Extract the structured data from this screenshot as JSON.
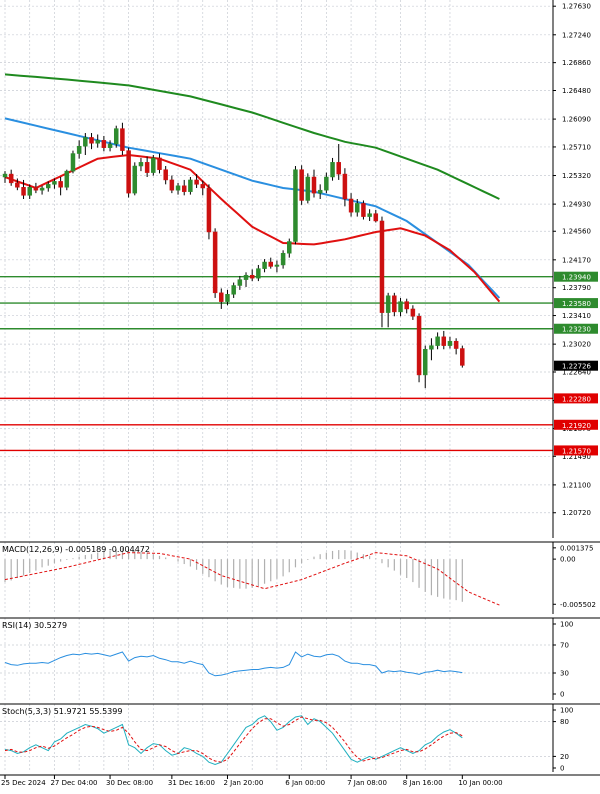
{
  "chart_data": [
    {
      "type": "candlestick",
      "pair_context": "price",
      "ylim": [
        1.2043,
        1.2766
      ],
      "y_ticks": [
        "1.27630",
        "1.27240",
        "1.26860",
        "1.26480",
        "1.26090",
        "1.25710",
        "1.25320",
        "1.24930",
        "1.24560",
        "1.24170",
        "1.23790",
        "1.23410",
        "1.23020",
        "1.22640",
        "1.22250",
        "1.21870",
        "1.21490",
        "1.21100",
        "1.20720"
      ],
      "current_price": "1.22726",
      "current_price_value": 1.22726,
      "support_resistance": [
        {
          "value": 1.2394,
          "label": "1.23940",
          "color": "#2e8b2e"
        },
        {
          "value": 1.2358,
          "label": "1.23580",
          "color": "#2e8b2e"
        },
        {
          "value": 1.2323,
          "label": "1.23230",
          "color": "#2e8b2e"
        },
        {
          "value": 1.2228,
          "label": "1.22280",
          "color": "#e00000"
        },
        {
          "value": 1.2192,
          "label": "1.21920",
          "color": "#e00000"
        },
        {
          "value": 1.2157,
          "label": "1.21570",
          "color": "#e00000"
        }
      ],
      "candles": [
        [
          1.253,
          1.2538,
          1.2522,
          1.2534
        ],
        [
          1.2534,
          1.254,
          1.2518,
          1.2522
        ],
        [
          1.2522,
          1.2528,
          1.2512,
          1.2516
        ],
        [
          1.2516,
          1.2526,
          1.25,
          1.2505
        ],
        [
          1.2505,
          1.252,
          1.25,
          1.2516
        ],
        [
          1.2516,
          1.2522,
          1.2508,
          1.2512
        ],
        [
          1.2512,
          1.2518,
          1.2506,
          1.2515
        ],
        [
          1.2515,
          1.2524,
          1.251,
          1.252
        ],
        [
          1.252,
          1.2528,
          1.2514,
          1.2524
        ],
        [
          1.2524,
          1.253,
          1.2505,
          1.2516
        ],
        [
          1.2516,
          1.254,
          1.2512,
          1.2538
        ],
        [
          1.2538,
          1.2566,
          1.2535,
          1.2562
        ],
        [
          1.2562,
          1.258,
          1.2555,
          1.2572
        ],
        [
          1.2572,
          1.259,
          1.256,
          1.2584
        ],
        [
          1.2584,
          1.259,
          1.2568,
          1.2576
        ],
        [
          1.2576,
          1.2588,
          1.257,
          1.258
        ],
        [
          1.258,
          1.2586,
          1.2565,
          1.257
        ],
        [
          1.257,
          1.258,
          1.2565,
          1.2575
        ],
        [
          1.2575,
          1.26,
          1.257,
          1.2596
        ],
        [
          1.2596,
          1.2604,
          1.256,
          1.2566
        ],
        [
          1.2566,
          1.257,
          1.2502,
          1.2508
        ],
        [
          1.2508,
          1.255,
          1.2505,
          1.2545
        ],
        [
          1.2545,
          1.2556,
          1.2538,
          1.255
        ],
        [
          1.255,
          1.2558,
          1.253,
          1.2536
        ],
        [
          1.2536,
          1.256,
          1.2532,
          1.2556
        ],
        [
          1.2556,
          1.2562,
          1.2535,
          1.254
        ],
        [
          1.254,
          1.2545,
          1.252,
          1.2526
        ],
        [
          1.2526,
          1.2532,
          1.2508,
          1.2512
        ],
        [
          1.2512,
          1.2522,
          1.2506,
          1.2518
        ],
        [
          1.2518,
          1.2526,
          1.2505,
          1.251
        ],
        [
          1.251,
          1.253,
          1.2506,
          1.2526
        ],
        [
          1.2526,
          1.2534,
          1.2515,
          1.252
        ],
        [
          1.252,
          1.2525,
          1.2505,
          1.2515
        ],
        [
          1.2515,
          1.252,
          1.2445,
          1.2455
        ],
        [
          1.2455,
          1.246,
          1.2365,
          1.2372
        ],
        [
          1.2372,
          1.2378,
          1.235,
          1.236
        ],
        [
          1.236,
          1.2376,
          1.2355,
          1.237
        ],
        [
          1.237,
          1.2386,
          1.2365,
          1.2382
        ],
        [
          1.2382,
          1.2395,
          1.2376,
          1.239
        ],
        [
          1.239,
          1.24,
          1.238,
          1.2396
        ],
        [
          1.2396,
          1.2404,
          1.2388,
          1.2392
        ],
        [
          1.2392,
          1.241,
          1.2388,
          1.2405
        ],
        [
          1.2405,
          1.2418,
          1.24,
          1.2414
        ],
        [
          1.2414,
          1.242,
          1.2405,
          1.2408
        ],
        [
          1.2408,
          1.2416,
          1.24,
          1.241
        ],
        [
          1.241,
          1.243,
          1.2405,
          1.2426
        ],
        [
          1.2426,
          1.2446,
          1.242,
          1.2442
        ],
        [
          1.2442,
          1.2545,
          1.2438,
          1.254
        ],
        [
          1.254,
          1.2546,
          1.2492,
          1.2498
        ],
        [
          1.2498,
          1.2535,
          1.2494,
          1.253
        ],
        [
          1.253,
          1.254,
          1.2502,
          1.2508
        ],
        [
          1.2508,
          1.252,
          1.25,
          1.2512
        ],
        [
          1.2512,
          1.2536,
          1.2508,
          1.253
        ],
        [
          1.253,
          1.2556,
          1.2525,
          1.255
        ],
        [
          1.255,
          1.2575,
          1.2526,
          1.2534
        ],
        [
          1.2534,
          1.2542,
          1.249,
          1.25
        ],
        [
          1.25,
          1.2508,
          1.2476,
          1.2482
        ],
        [
          1.2482,
          1.25,
          1.2476,
          1.2494
        ],
        [
          1.2494,
          1.2498,
          1.2472,
          1.2476
        ],
        [
          1.2476,
          1.2486,
          1.247,
          1.248
        ],
        [
          1.248,
          1.2485,
          1.2468,
          1.247
        ],
        [
          1.247,
          1.2476,
          1.2325,
          1.2345
        ],
        [
          1.2345,
          1.2372,
          1.2325,
          1.2368
        ],
        [
          1.2368,
          1.2372,
          1.234,
          1.2346
        ],
        [
          1.2346,
          1.2365,
          1.234,
          1.236
        ],
        [
          1.236,
          1.2364,
          1.2344,
          1.235
        ],
        [
          1.235,
          1.2355,
          1.2335,
          1.234
        ],
        [
          1.234,
          1.2344,
          1.225,
          1.226
        ],
        [
          1.226,
          1.23,
          1.2242,
          1.2295
        ],
        [
          1.2295,
          1.231,
          1.228,
          1.23
        ],
        [
          1.23,
          1.2318,
          1.2295,
          1.2312
        ],
        [
          1.2312,
          1.232,
          1.2295,
          1.23
        ],
        [
          1.23,
          1.2312,
          1.2296,
          1.2306
        ],
        [
          1.2306,
          1.231,
          1.2288,
          1.2296
        ],
        [
          1.2296,
          1.23,
          1.227,
          1.2273
        ]
      ],
      "ma_green": [
        [
          0,
          1.267
        ],
        [
          10,
          1.2663
        ],
        [
          20,
          1.2655
        ],
        [
          30,
          1.264
        ],
        [
          40,
          1.2618
        ],
        [
          50,
          1.259
        ],
        [
          55,
          1.2578
        ],
        [
          60,
          1.257
        ],
        [
          65,
          1.2555
        ],
        [
          70,
          1.254
        ],
        [
          75,
          1.252
        ],
        [
          80,
          1.25
        ]
      ],
      "ma_blue": [
        [
          0,
          1.261
        ],
        [
          10,
          1.259
        ],
        [
          20,
          1.257
        ],
        [
          30,
          1.2555
        ],
        [
          35,
          1.254
        ],
        [
          40,
          1.2525
        ],
        [
          45,
          1.2515
        ],
        [
          50,
          1.251
        ],
        [
          55,
          1.25
        ],
        [
          60,
          1.249
        ],
        [
          65,
          1.247
        ],
        [
          70,
          1.244
        ],
        [
          75,
          1.241
        ],
        [
          80,
          1.2365
        ]
      ],
      "ma_red": [
        [
          0,
          1.253
        ],
        [
          5,
          1.2515
        ],
        [
          10,
          1.2535
        ],
        [
          15,
          1.2555
        ],
        [
          20,
          1.256
        ],
        [
          25,
          1.2555
        ],
        [
          30,
          1.254
        ],
        [
          35,
          1.25
        ],
        [
          40,
          1.2462
        ],
        [
          45,
          1.244
        ],
        [
          50,
          1.2438
        ],
        [
          55,
          1.2445
        ],
        [
          60,
          1.2455
        ],
        [
          64,
          1.246
        ],
        [
          68,
          1.245
        ],
        [
          72,
          1.243
        ],
        [
          76,
          1.24
        ],
        [
          80,
          1.236
        ]
      ]
    },
    {
      "type": "histogram",
      "name": "MACD",
      "label": "MACD(12,26,9) -0.005189 -0.004472",
      "ylim": [
        -0.0062,
        0.0016
      ],
      "y_ticks": [
        "0.001375",
        "0.00",
        "-0.005502"
      ],
      "y_tick_values": [
        0.001375,
        0.0,
        -0.005502
      ],
      "bars": [
        -0.0028,
        -0.0026,
        -0.0023,
        -0.002,
        -0.0017,
        -0.0014,
        -0.001,
        -0.0008,
        -0.0005,
        -0.0003,
        -0.0001,
        0.0001,
        0.0003,
        0.0005,
        0.0006,
        0.0008,
        0.0009,
        0.001,
        0.0012,
        0.0014,
        0.0012,
        0.001,
        0.0009,
        0.0008,
        0.0006,
        0.0004,
        0.0002,
        0.0,
        -0.0003,
        -0.0006,
        -0.0009,
        -0.0013,
        -0.0018,
        -0.0022,
        -0.0027,
        -0.0031,
        -0.0034,
        -0.0035,
        -0.0036,
        -0.0036,
        -0.0035,
        -0.0033,
        -0.003,
        -0.0027,
        -0.0024,
        -0.0021,
        -0.0016,
        -0.001,
        -0.0005,
        -0.0001,
        0.0003,
        0.0006,
        0.0008,
        0.001,
        0.0011,
        0.0011,
        0.001,
        0.0008,
        0.0006,
        0.0004,
        0.0001,
        -0.0005,
        -0.001,
        -0.0014,
        -0.0019,
        -0.0023,
        -0.0028,
        -0.0035,
        -0.004,
        -0.0044,
        -0.0046,
        -0.0048,
        -0.0049,
        -0.005,
        -0.0052
      ],
      "signal": [
        [
          0,
          -0.0025
        ],
        [
          10,
          -0.001
        ],
        [
          20,
          0.0008
        ],
        [
          25,
          0.0007
        ],
        [
          30,
          0.0
        ],
        [
          35,
          -0.002
        ],
        [
          42,
          -0.0036
        ],
        [
          48,
          -0.0025
        ],
        [
          55,
          -0.0005
        ],
        [
          60,
          0.0008
        ],
        [
          65,
          0.0004
        ],
        [
          70,
          -0.0012
        ],
        [
          75,
          -0.004
        ],
        [
          80,
          -0.0056
        ]
      ]
    },
    {
      "type": "line",
      "name": "RSI",
      "label": "RSI(14) 30.5279",
      "ylim": [
        0,
        100
      ],
      "y_ticks": [
        "100",
        "70",
        "30",
        "0"
      ],
      "y_tick_values": [
        100,
        70,
        30,
        0
      ],
      "series": [
        45,
        42,
        41,
        43,
        44,
        44,
        45,
        44,
        48,
        52,
        55,
        57,
        56,
        58,
        57,
        58,
        56,
        54,
        57,
        60,
        47,
        52,
        54,
        53,
        55,
        51,
        49,
        46,
        46,
        44,
        47,
        44,
        42,
        30,
        26,
        27,
        29,
        32,
        33,
        34,
        35,
        35,
        37,
        38,
        37,
        38,
        42,
        60,
        53,
        57,
        54,
        53,
        56,
        57,
        54,
        47,
        44,
        44,
        42,
        42,
        40,
        30,
        33,
        32,
        33,
        31,
        30,
        28,
        31,
        32,
        34,
        32,
        33,
        32,
        30.5
      ]
    },
    {
      "type": "line",
      "name": "Stoch",
      "label": "Stoch(5,3,3) 51.9721 55.5399",
      "ylim": [
        0,
        100
      ],
      "y_ticks": [
        "100",
        "80",
        "20",
        "0"
      ],
      "y_tick_values": [
        100,
        80,
        20,
        0
      ],
      "k": [
        32,
        30,
        25,
        28,
        35,
        40,
        35,
        30,
        45,
        50,
        60,
        65,
        70,
        75,
        72,
        68,
        60,
        65,
        70,
        75,
        40,
        35,
        25,
        35,
        42,
        40,
        30,
        22,
        25,
        35,
        32,
        25,
        20,
        10,
        6,
        10,
        25,
        40,
        55,
        70,
        75,
        85,
        90,
        80,
        65,
        70,
        80,
        88,
        90,
        75,
        85,
        80,
        70,
        60,
        45,
        30,
        15,
        10,
        15,
        20,
        15,
        20,
        25,
        30,
        35,
        30,
        25,
        30,
        40,
        45,
        55,
        62,
        66,
        60,
        52
      ],
      "d": [
        30,
        32,
        28,
        27,
        30,
        35,
        38,
        34,
        38,
        45,
        52,
        58,
        65,
        70,
        72,
        70,
        66,
        63,
        65,
        70,
        60,
        45,
        32,
        30,
        35,
        40,
        37,
        30,
        25,
        28,
        30,
        30,
        25,
        17,
        12,
        10,
        15,
        28,
        42,
        55,
        68,
        78,
        85,
        85,
        78,
        72,
        75,
        82,
        88,
        85,
        82,
        82,
        78,
        70,
        58,
        45,
        30,
        18,
        12,
        15,
        17,
        18,
        22,
        26,
        30,
        32,
        28,
        28,
        33,
        40,
        48,
        55,
        60,
        61,
        55.5
      ]
    }
  ],
  "x_axis": {
    "labels": [
      "25 Dec 2024",
      "27 Dec 04:00",
      "30 Dec 08:00",
      "31 Dec 16:00",
      "2 Jan 20:00",
      "6 Jan 00:00",
      "7 Jan 08:00",
      "8 Jan 16:00",
      "10 Jan 00:00"
    ],
    "label_candle_index": [
      0,
      8,
      17,
      27,
      36,
      46,
      56,
      65,
      74
    ]
  },
  "colors": {
    "bull": "#2e8b2e",
    "bear": "#cc1010",
    "ma_green": "#1f8a1f",
    "ma_blue": "#2a8fe0",
    "ma_red": "#e01010",
    "indicator_line": "#2a8fe0",
    "signal_line": "#e01010",
    "grid": "#c8ccd4",
    "axis_text": "#000000",
    "price_tag_bg": "#000000"
  }
}
